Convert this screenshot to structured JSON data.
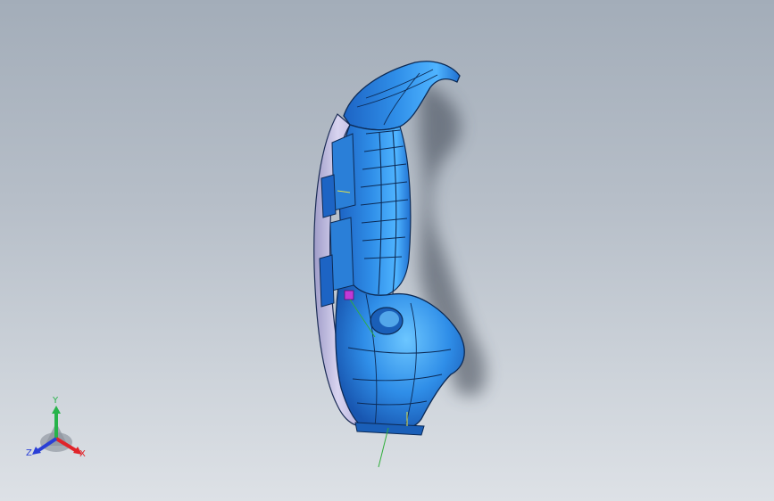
{
  "viewport": {
    "background_top": "#a3adb9",
    "background_bottom": "#dde1e6",
    "part_color": "#2f8ee8",
    "part_highlight": "#4fb4ff",
    "part_shadow": "#1a5fb8",
    "edge_color": "#0c2a55",
    "inner_surface": "#c4bfe0"
  },
  "triad": {
    "y_label": "Y",
    "x_label": "X",
    "z_label": "Z",
    "x_color": "#e0242a",
    "y_color": "#27b34a",
    "z_color": "#2a3fd6"
  }
}
